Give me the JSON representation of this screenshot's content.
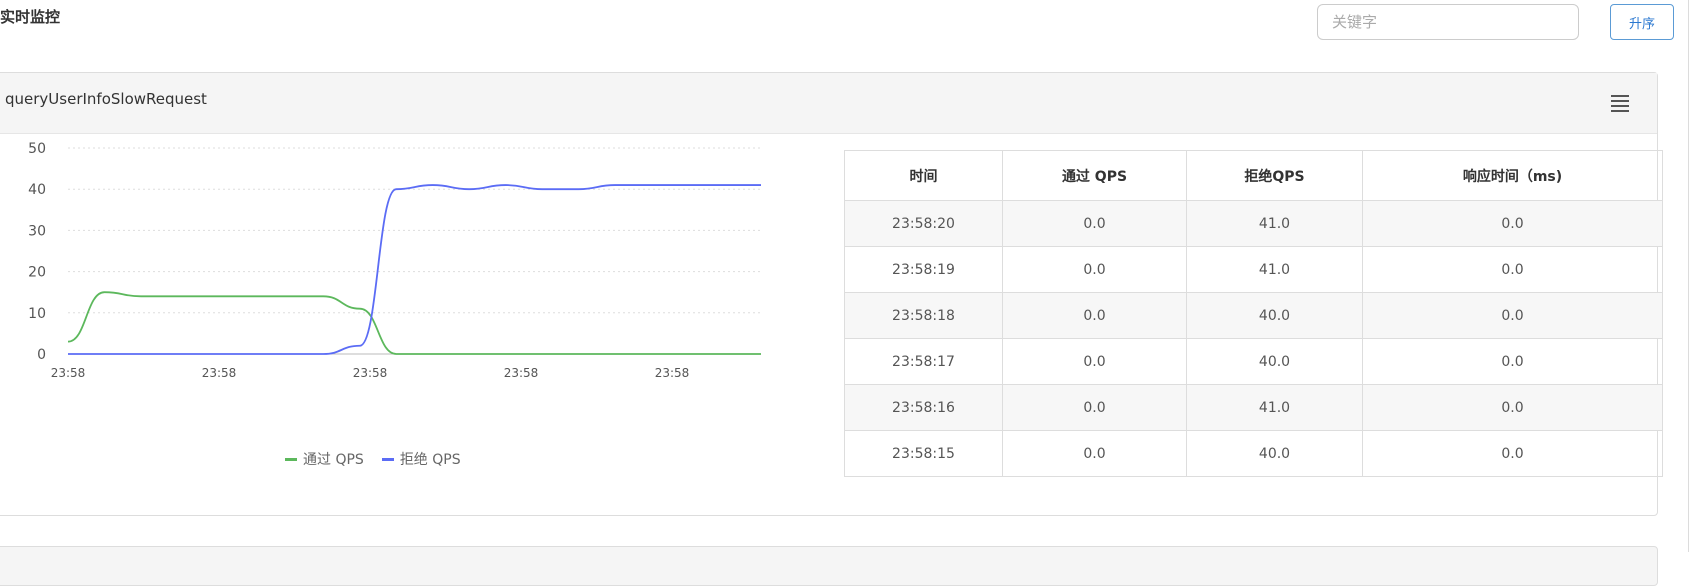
{
  "header": {
    "title": "实时监控",
    "search_placeholder": "关键字",
    "sort_label": "升序"
  },
  "panel": {
    "title": "queryUserInfoSlowRequest"
  },
  "chart_data": {
    "type": "line",
    "x": [
      "23:58",
      "23:58",
      "23:58",
      "23:58",
      "23:58"
    ],
    "ylim": [
      0,
      50
    ],
    "y_ticks": [
      0,
      10,
      20,
      30,
      40,
      50
    ],
    "grid": true,
    "legend_position": "bottom",
    "series": [
      {
        "name": "通过 QPS",
        "color": "#5cb85c",
        "values": [
          3,
          15,
          14,
          14,
          14,
          14,
          14,
          14,
          11,
          0,
          0,
          0,
          0,
          0,
          0,
          0,
          0,
          0,
          0,
          0
        ]
      },
      {
        "name": "拒绝 QPS",
        "color": "#5b6cf5",
        "values": [
          0,
          0,
          0,
          0,
          0,
          0,
          0,
          0,
          2,
          40,
          41,
          40,
          41,
          40,
          40,
          41,
          41,
          41,
          41,
          41
        ]
      }
    ]
  },
  "table": {
    "columns": [
      "时间",
      "通过 QPS",
      "拒绝QPS",
      "响应时间（ms)"
    ],
    "rows": [
      [
        "23:58:20",
        "0.0",
        "41.0",
        "0.0"
      ],
      [
        "23:58:19",
        "0.0",
        "41.0",
        "0.0"
      ],
      [
        "23:58:18",
        "0.0",
        "40.0",
        "0.0"
      ],
      [
        "23:58:17",
        "0.0",
        "40.0",
        "0.0"
      ],
      [
        "23:58:16",
        "0.0",
        "41.0",
        "0.0"
      ],
      [
        "23:58:15",
        "0.0",
        "40.0",
        "0.0"
      ]
    ]
  }
}
